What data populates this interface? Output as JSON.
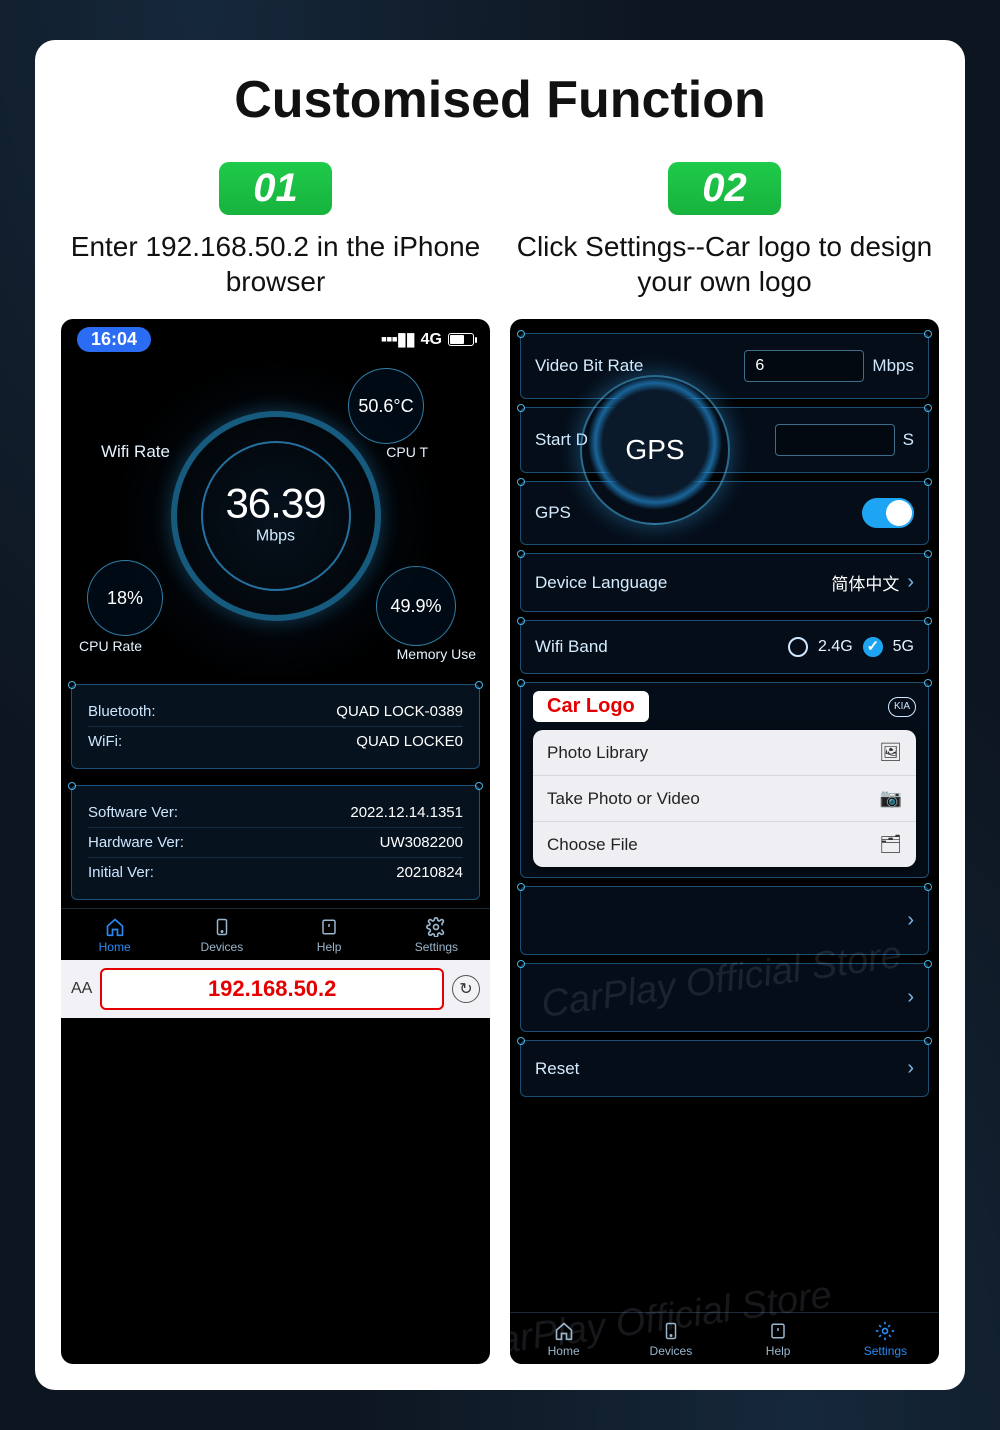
{
  "title": "Customised Function",
  "steps": {
    "one": {
      "badge": "01",
      "caption": "Enter 192.168.50.2 in the iPhone browser"
    },
    "two": {
      "badge": "02",
      "caption": "Click Settings--Car logo to design your own logo"
    }
  },
  "phone": {
    "statusbar": {
      "time": "16:04",
      "net": "4G"
    },
    "dash": {
      "wifi_rate_label": "Wifi Rate",
      "center_value": "36.39",
      "center_unit": "Mbps",
      "cpu_temp": {
        "value": "50.6°C",
        "label": "CPU T"
      },
      "cpu_rate": {
        "value": "18%",
        "label": "CPU Rate"
      },
      "memory": {
        "value": "49.9%",
        "label": "Memory Use"
      }
    },
    "conn": {
      "bluetooth_label": "Bluetooth:",
      "bluetooth_value": "QUAD LOCK-0389",
      "wifi_label": "WiFi:",
      "wifi_value": "QUAD LOCKE0"
    },
    "versions": {
      "software_label": "Software Ver:",
      "software_value": "2022.12.14.1351",
      "hardware_label": "Hardware Ver:",
      "hardware_value": "UW3082200",
      "initial_label": "Initial Ver:",
      "initial_value": "20210824"
    },
    "tabs": {
      "home": "Home",
      "devices": "Devices",
      "help": "Help",
      "settings": "Settings"
    },
    "urlbar": {
      "aa": "AA",
      "url": "192.168.50.2",
      "reload": "↻"
    }
  },
  "settings": {
    "gps_bubble": "GPS",
    "rows": {
      "video_bitrate": {
        "label": "Video Bit Rate",
        "value": "6",
        "unit": "Mbps"
      },
      "start_d": {
        "label": "Start D",
        "unit": "S"
      },
      "gps": {
        "label": "GPS"
      },
      "language": {
        "label": "Device Language",
        "value": "简体中文"
      },
      "wifi_band": {
        "label": "Wifi Band",
        "opt1": "2.4G",
        "opt2": "5G"
      },
      "car_logo": {
        "pill": "Car Logo",
        "brand": "KIA",
        "popup": {
          "photo_library": "Photo Library",
          "take_photo": "Take Photo or Video",
          "choose_file": "Choose File"
        }
      },
      "reset": {
        "label": "Reset"
      }
    },
    "tabs": {
      "home": "Home",
      "devices": "Devices",
      "help": "Help",
      "settings": "Settings"
    }
  },
  "watermark": "CarPlay Official Store",
  "colors": {
    "accent": "#1da4f2",
    "green": "#1fca4a",
    "danger": "#e40000",
    "cyan": "#4ec8ff"
  }
}
